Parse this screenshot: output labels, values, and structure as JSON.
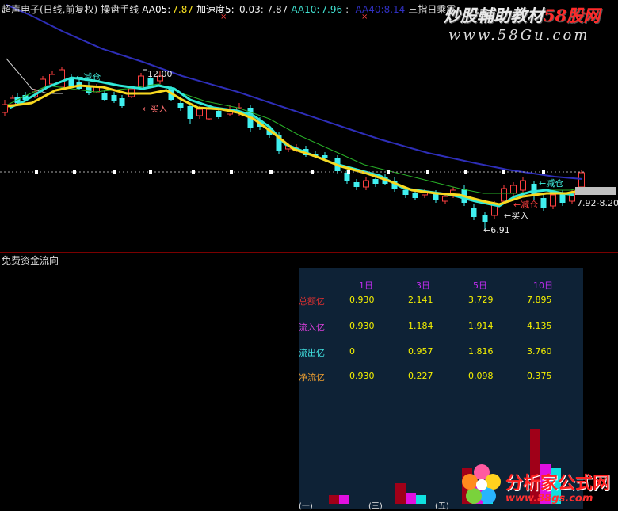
{
  "header": {
    "stock": "超声电子(日线,前复权)",
    "indicator": "操盘手线",
    "aa05_label": "AA05:",
    "aa05_value": "7.87",
    "speed_label": "加速度5:",
    "speed_value": "-0.03",
    "speed_extra": ": 7.87",
    "aa10_label": "AA10:",
    "aa10_value": "7.96",
    "sep": ":-",
    "hidden_label": "AA40:8.14",
    "right_label": "三指日乘露"
  },
  "watermarks": {
    "site1_a": "炒股輔助教材",
    "site1_b": "58股网",
    "site1_url": "www.58Gu.com",
    "site2_name": "分析家公式网",
    "site2_url": "www.88gs.com"
  },
  "chart_annotations": {
    "reduce1": "←减仓",
    "high": "12.00",
    "buy1": "←买入",
    "reduce2": "←减仓",
    "reduce3": "←减仓",
    "buy2": "←买入",
    "low": "←6.91",
    "range": "7.92-8.20"
  },
  "colors": {
    "up": "#ff4040",
    "down": "#40f0f0",
    "ma_yellow": "#f8e020",
    "ma_blue": "#3030c0",
    "ma_green": "#30c030",
    "ma_white": "#d0d0d0"
  },
  "flow_panel": {
    "title": "免费资金流向",
    "columns": [
      "1日",
      "3日",
      "5日",
      "10日"
    ],
    "rows": [
      {
        "label": "总额亿",
        "color": "#e03030",
        "values": [
          "0.930",
          "2.141",
          "3.729",
          "7.895"
        ]
      },
      {
        "label": "流入亿",
        "color": "#e040e0",
        "values": [
          "0.930",
          "1.184",
          "1.914",
          "4.135"
        ]
      },
      {
        "label": "流出亿",
        "color": "#40e0e0",
        "values": [
          "0",
          "0.957",
          "1.816",
          "3.760"
        ]
      },
      {
        "label": "净流亿",
        "color": "#f0a030",
        "values": [
          "0.930",
          "0.227",
          "0.098",
          "0.375"
        ]
      }
    ],
    "bar_values": [
      {
        "total": 0.93,
        "in": 0.93,
        "out": 0
      },
      {
        "total": 2.141,
        "in": 1.184,
        "out": 0.957
      },
      {
        "total": 3.729,
        "in": 1.914,
        "out": 1.816
      },
      {
        "total": 7.895,
        "in": 4.135,
        "out": 3.76
      }
    ],
    "bottom_labels": [
      "(一)",
      "(三)",
      "(五)"
    ]
  }
}
